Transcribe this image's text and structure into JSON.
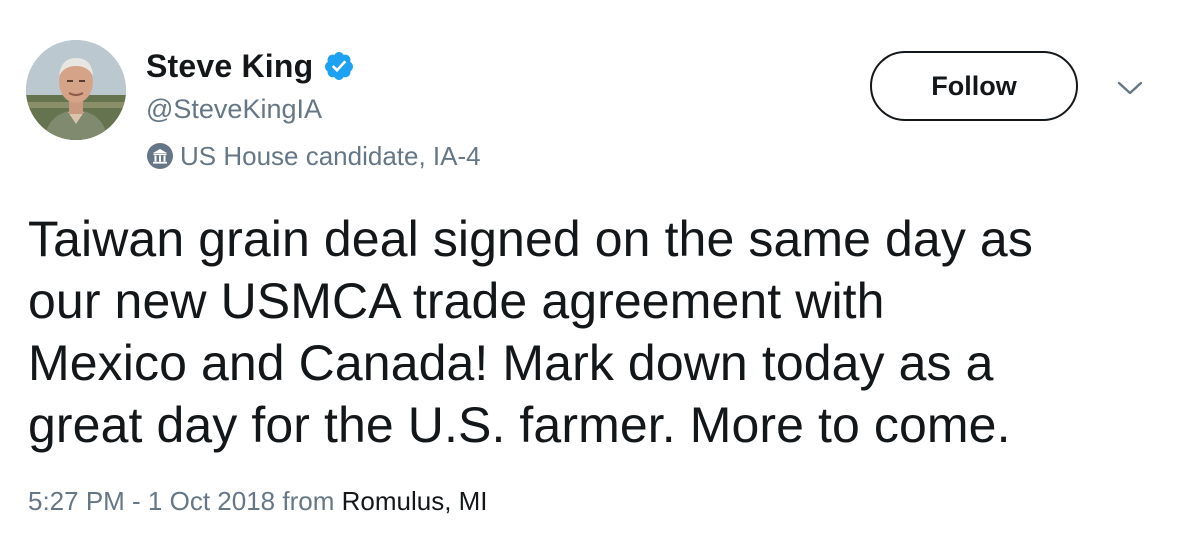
{
  "author": {
    "display_name": "Steve King",
    "handle": "@SteveKingIA",
    "label": "US House candidate, IA-4",
    "verified": true,
    "avatar_icon": "profile-photo"
  },
  "actions": {
    "follow_label": "Follow",
    "more_icon": "chevron-down-icon"
  },
  "tweet": {
    "lines": [
      "Taiwan grain deal signed on the same day as",
      "our new USMCA trade agreement with",
      "Mexico and Canada! Mark down today as a",
      "great day for the U.S. farmer. More to come."
    ]
  },
  "meta": {
    "timestamp": "5:27 PM - 1 Oct 2018",
    "from_label": "from",
    "location": "Romulus, MI"
  },
  "colors": {
    "text": "#14171a",
    "secondary": "#657786",
    "verified_blue": "#1da1f2"
  }
}
